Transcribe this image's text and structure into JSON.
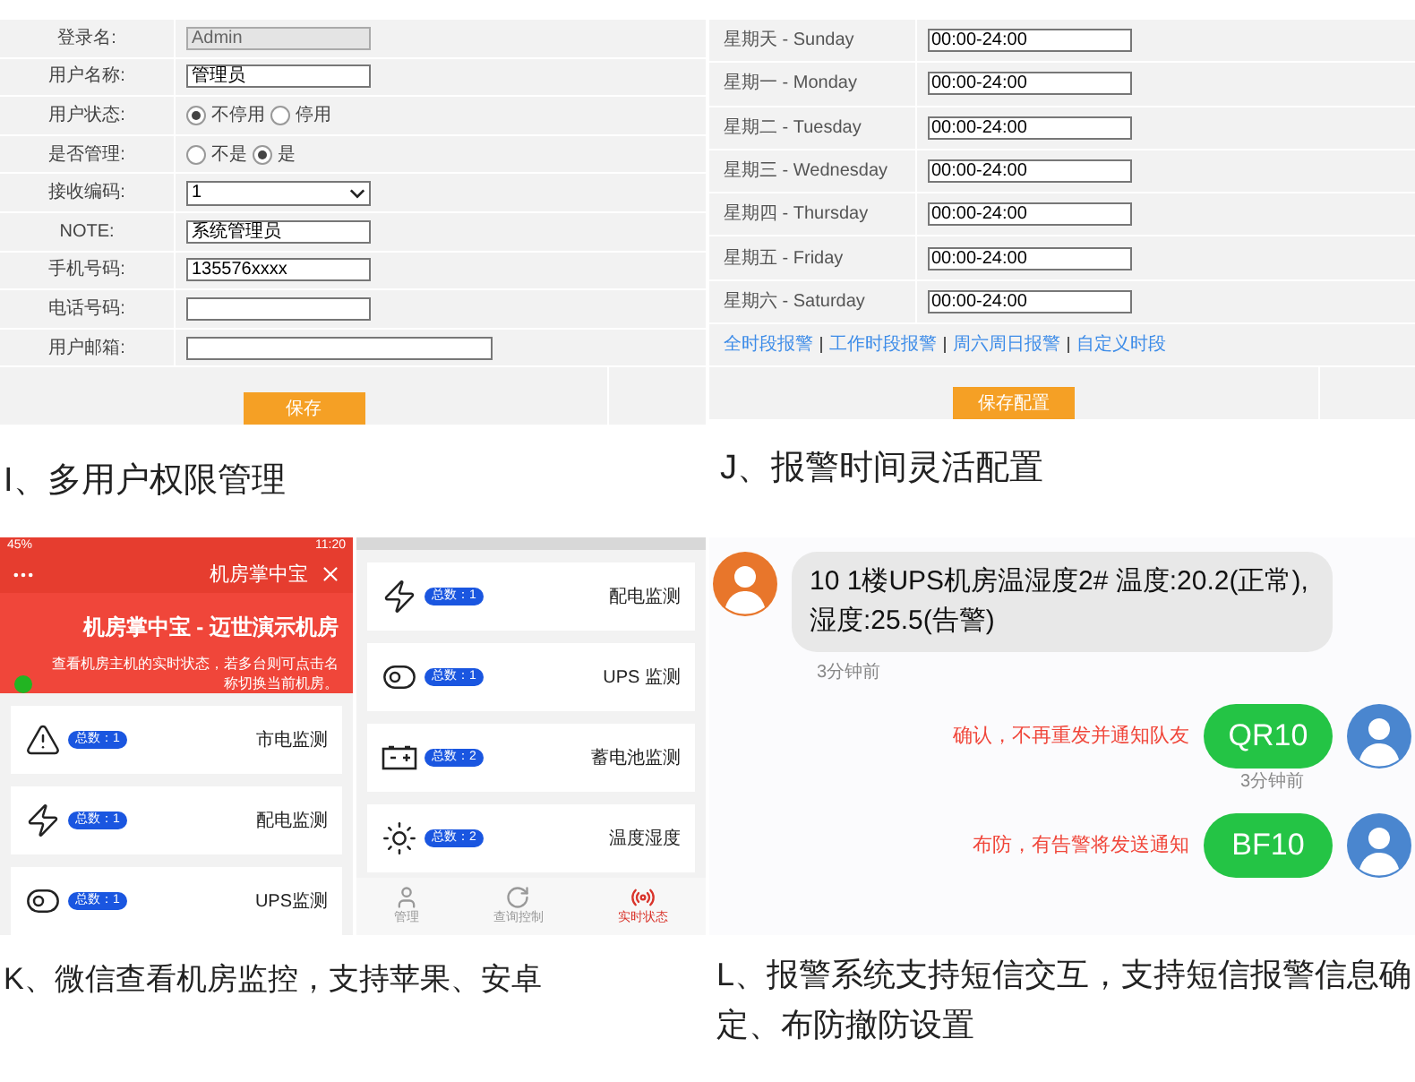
{
  "user_form": {
    "rows": [
      {
        "label": "登录名:",
        "kind": "disabled",
        "value": "Admin"
      },
      {
        "label": "用户名称:",
        "kind": "text",
        "value": "管理员"
      },
      {
        "label": "用户状态:",
        "kind": "radio",
        "options": [
          {
            "label": "不停用",
            "selected": true
          },
          {
            "label": "停用",
            "selected": false
          }
        ]
      },
      {
        "label": "是否管理:",
        "kind": "radio",
        "options": [
          {
            "label": "不是",
            "selected": false
          },
          {
            "label": "是",
            "selected": true
          }
        ]
      },
      {
        "label": "接收编码:",
        "kind": "select",
        "value": "1"
      },
      {
        "label": "NOTE:",
        "kind": "text",
        "value": "系统管理员"
      },
      {
        "label": "手机号码:",
        "kind": "text",
        "value": "135576xxxx"
      },
      {
        "label": "电话号码:",
        "kind": "text"
      },
      {
        "label": "用户邮箱:",
        "kind": "wide"
      }
    ],
    "save_button": "保存",
    "caption": "I、多用户权限管理"
  },
  "schedule": {
    "rows": [
      {
        "label": "星期天 - Sunday",
        "value": "00:00-24:00"
      },
      {
        "label": "星期一 - Monday",
        "value": "00:00-24:00"
      },
      {
        "label": "星期二 - Tuesday",
        "value": "00:00-24:00"
      },
      {
        "label": "星期三 - Wednesday",
        "value": "00:00-24:00"
      },
      {
        "label": "星期四 - Thursday",
        "value": "00:00-24:00"
      },
      {
        "label": "星期五 - Friday",
        "value": "00:00-24:00"
      },
      {
        "label": "星期六 - Saturday",
        "value": "00:00-24:00"
      }
    ],
    "links": [
      "全时段报警",
      "工作时段报警",
      "周六周日报警",
      "自定义时段"
    ],
    "save_button": "保存配置",
    "caption": "J、报警时间灵活配置"
  },
  "phone_left": {
    "status_time": "11:20",
    "battery": "45%",
    "title": "机房掌中宝",
    "banner_title": "机房掌中宝 - 迈世演示机房",
    "banner_text": "查看机房主机的实时状态，若多台则可点击名称切换当前机房。",
    "cards": [
      {
        "name": "市电监测",
        "count": "总数：1",
        "kind": "warning"
      },
      {
        "name": "配电监测",
        "count": "总数：1",
        "kind": "electric"
      },
      {
        "name": "UPS监测",
        "count": "总数：1",
        "kind": "toggle"
      }
    ]
  },
  "phone_right": {
    "cards": [
      {
        "name": "配电监测",
        "count": "总数：1",
        "kind": "electric"
      },
      {
        "name": "UPS 监测",
        "count": "总数：1",
        "kind": "toggle"
      },
      {
        "name": "蓄电池监测",
        "count": "总数：2",
        "kind": "battery"
      },
      {
        "name": "温度湿度",
        "count": "总数：2",
        "kind": "sun"
      }
    ],
    "tabs": [
      {
        "label": "管理",
        "kind": "user",
        "selected": false
      },
      {
        "label": "查询控制",
        "kind": "refresh",
        "selected": false
      },
      {
        "label": "实时状态",
        "kind": "radio",
        "selected": true
      }
    ]
  },
  "phones_caption": "K、微信查看机房监控，支持苹果、安卓",
  "chat": {
    "incoming": {
      "text": "10 1楼UPS机房温湿度2# 温度:20.2(正常),湿度:25.5(告警)",
      "time": "3分钟前"
    },
    "outgoing": [
      {
        "note": "确认，不再重发并通知队友",
        "text": "QR10",
        "time": "3分钟前"
      },
      {
        "note": "布防，有告警将发送通知",
        "text": "BF10"
      }
    ],
    "caption": "L、报警系统支持短信交互，支持短信报警信息确定、布防撤防设置"
  }
}
